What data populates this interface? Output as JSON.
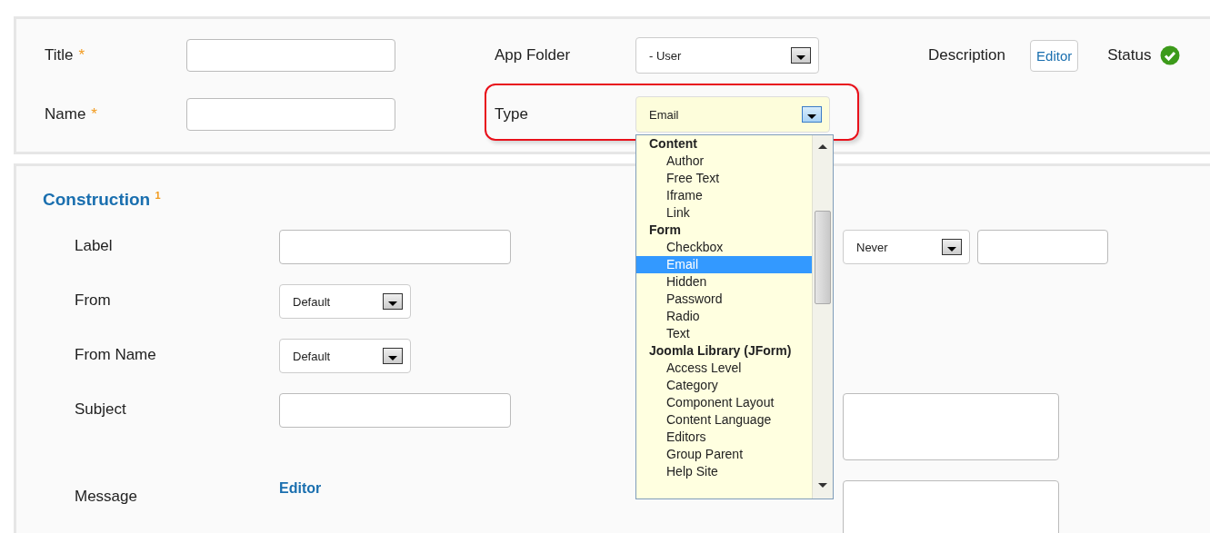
{
  "header": {
    "fields": [
      {
        "label": "Title",
        "required_mark": "*",
        "kind": "text"
      },
      {
        "label": "App Folder",
        "kind": "select",
        "value": "- User"
      },
      {
        "label": "Name",
        "required_mark": "*",
        "kind": "text"
      },
      {
        "label": "Type",
        "kind": "select",
        "value": "Email",
        "focused": true
      }
    ],
    "description": {
      "label": "Description",
      "button": "Editor"
    },
    "status": {
      "label": "Status",
      "on": true
    }
  },
  "type_dropdown": {
    "groups": [
      {
        "label": "Content",
        "options": [
          {
            "label": "Author",
            "selected": false
          },
          {
            "label": "Free Text",
            "selected": false
          },
          {
            "label": "Iframe",
            "selected": false
          },
          {
            "label": "Link",
            "selected": false
          }
        ]
      },
      {
        "label": "Form",
        "options": [
          {
            "label": "Checkbox",
            "selected": false
          },
          {
            "label": "Email",
            "selected": true
          },
          {
            "label": "Hidden",
            "selected": false
          },
          {
            "label": "Password",
            "selected": false
          },
          {
            "label": "Radio",
            "selected": false
          },
          {
            "label": "Text",
            "selected": false
          }
        ]
      },
      {
        "label": "Joomla Library (JForm)",
        "options": [
          {
            "label": "Access Level",
            "selected": false
          },
          {
            "label": "Category",
            "selected": false
          },
          {
            "label": "Component Layout",
            "selected": false
          },
          {
            "label": "Content Language",
            "selected": false
          },
          {
            "label": "Editors",
            "selected": false
          },
          {
            "label": "Group Parent",
            "selected": false
          },
          {
            "label": "Help Site",
            "selected": false
          }
        ]
      }
    ]
  },
  "construction": {
    "title": "Construction $^{1}$",
    "rows": [
      {
        "label": "Label",
        "field": {
          "kind": "text"
        },
        "extra": [
          {
            "kind": "select",
            "value": "Never"
          },
          {
            "kind": "text"
          }
        ]
      },
      {
        "label": "From",
        "field": {
          "kind": "select",
          "value": "Default"
        },
        "extra": []
      },
      {
        "label": "From Name",
        "field": {
          "kind": "select",
          "value": "Default"
        },
        "extra": []
      },
      {
        "label": "Subject",
        "field": {
          "kind": "text"
        },
        "extra": [
          {
            "kind": "textarea"
          }
        ]
      },
      {
        "label": "Message",
        "field": {
          "kind": "link",
          "value": "Editor"
        },
        "extra": [
          {
            "kind": "textarea"
          }
        ]
      }
    ]
  }
}
